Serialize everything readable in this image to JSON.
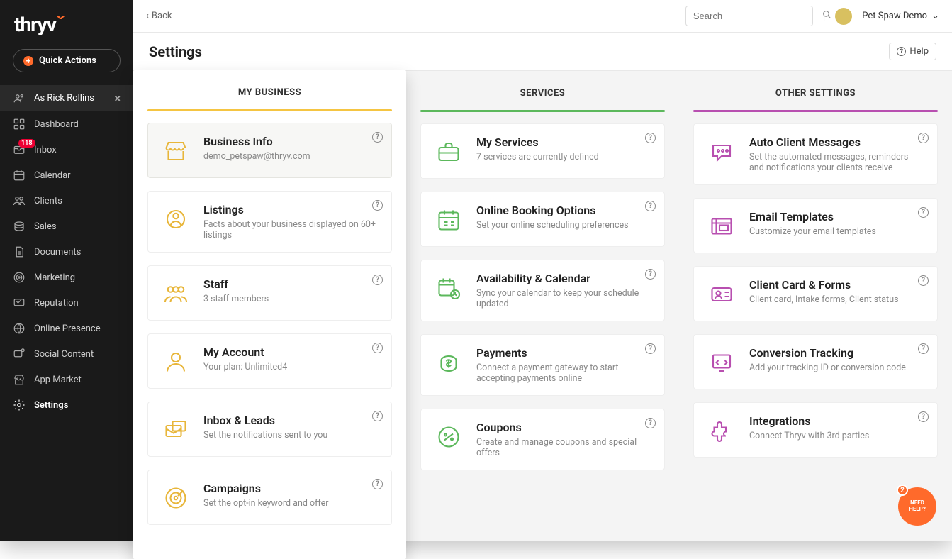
{
  "brand": {
    "name": "thryv",
    "accent": "#ff6a2b"
  },
  "quick_actions_label": "Quick Actions",
  "sidebar": {
    "as_user_label": "As Rick Rollins",
    "items": [
      {
        "label": "Dashboard"
      },
      {
        "label": "Inbox",
        "badge": "118"
      },
      {
        "label": "Calendar"
      },
      {
        "label": "Clients"
      },
      {
        "label": "Sales"
      },
      {
        "label": "Documents"
      },
      {
        "label": "Marketing"
      },
      {
        "label": "Reputation"
      },
      {
        "label": "Online Presence"
      },
      {
        "label": "Social Content"
      },
      {
        "label": "App Market"
      },
      {
        "label": "Settings"
      }
    ]
  },
  "topbar": {
    "back": "Back",
    "search_placeholder": "Search",
    "account_name": "Pet Spaw Demo"
  },
  "page": {
    "title": "Settings",
    "help": "Help"
  },
  "columns": {
    "biz": {
      "title": "MY BUSINESS",
      "cards": [
        {
          "title": "Business Info",
          "desc": "demo_petspaw@thryv.com"
        },
        {
          "title": "Listings",
          "desc": "Facts about your business displayed on 60+ listings"
        },
        {
          "title": "Staff",
          "desc": "3 staff members"
        },
        {
          "title": "My Account",
          "desc": "Your plan: Unlimited4"
        },
        {
          "title": "Inbox & Leads",
          "desc": "Set the notifications sent to you"
        },
        {
          "title": "Campaigns",
          "desc": "Set the opt-in keyword and offer"
        }
      ]
    },
    "svc": {
      "title": "SERVICES",
      "cards": [
        {
          "title": "My Services",
          "desc": "7 services are currently defined"
        },
        {
          "title": "Online Booking Options",
          "desc": "Set your online scheduling preferences"
        },
        {
          "title": "Availability & Calendar",
          "desc": "Sync your calendar to keep your schedule updated"
        },
        {
          "title": "Payments",
          "desc": "Connect a payment gateway to start accepting payments online"
        },
        {
          "title": "Coupons",
          "desc": "Create and manage coupons and special offers"
        }
      ]
    },
    "oth": {
      "title": "OTHER SETTINGS",
      "cards": [
        {
          "title": "Auto Client Messages",
          "desc": "Set the automated messages, reminders and notifications your clients receive"
        },
        {
          "title": "Email Templates",
          "desc": "Customize your email templates"
        },
        {
          "title": "Client Card & Forms",
          "desc": "Client card, Intake forms, Client status"
        },
        {
          "title": "Conversion Tracking",
          "desc": "Add your tracking ID or conversion code"
        },
        {
          "title": "Integrations",
          "desc": "Connect Thryv with 3rd parties"
        }
      ]
    }
  },
  "fab": {
    "line1": "NEED",
    "line2": "HELP?",
    "badge": "2"
  }
}
